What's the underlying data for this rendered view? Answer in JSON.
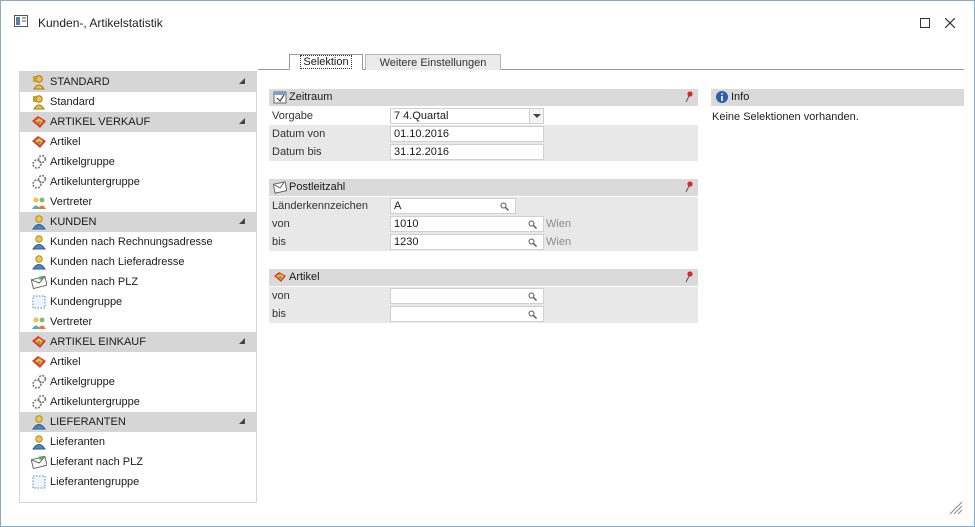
{
  "window": {
    "title": "Kunden-, Artikelstatistik"
  },
  "sidebar": {
    "items": [
      {
        "label": "STANDARD",
        "header": true,
        "icon": "key-person-icon"
      },
      {
        "label": "Standard",
        "header": false,
        "icon": "key-person-icon"
      },
      {
        "label": "ARTIKEL VERKAUF",
        "header": true,
        "icon": "article-icon"
      },
      {
        "label": "Artikel",
        "header": false,
        "icon": "article-icon"
      },
      {
        "label": "Artikelgruppe",
        "header": false,
        "icon": "gear-cluster-icon"
      },
      {
        "label": "Artikeluntergruppe",
        "header": false,
        "icon": "gear-cluster-icon"
      },
      {
        "label": "Vertreter",
        "header": false,
        "icon": "group-people-icon"
      },
      {
        "label": "KUNDEN",
        "header": true,
        "icon": "person-icon"
      },
      {
        "label": "Kunden nach Rechnungsadresse",
        "header": false,
        "icon": "person-icon"
      },
      {
        "label": "Kunden nach Lieferadresse",
        "header": false,
        "icon": "person-icon"
      },
      {
        "label": "Kunden nach PLZ",
        "header": false,
        "icon": "envelope-icon"
      },
      {
        "label": "Kundengruppe",
        "header": false,
        "icon": "dotted-frame-icon"
      },
      {
        "label": "Vertreter",
        "header": false,
        "icon": "group-people-icon"
      },
      {
        "label": "ARTIKEL EINKAUF",
        "header": true,
        "icon": "article-icon"
      },
      {
        "label": "Artikel",
        "header": false,
        "icon": "article-icon"
      },
      {
        "label": "Artikelgruppe",
        "header": false,
        "icon": "gear-cluster-icon"
      },
      {
        "label": "Artikeluntergruppe",
        "header": false,
        "icon": "gear-cluster-icon"
      },
      {
        "label": "LIEFERANTEN",
        "header": true,
        "icon": "person-icon"
      },
      {
        "label": "Lieferanten",
        "header": false,
        "icon": "person-icon"
      },
      {
        "label": "Lieferant nach PLZ",
        "header": false,
        "icon": "envelope-icon"
      },
      {
        "label": "Lieferantengruppe",
        "header": false,
        "icon": "dotted-frame-icon"
      }
    ]
  },
  "tabs": {
    "selektion": "Selektion",
    "weitere": "Weitere Einstellungen"
  },
  "zeitraum": {
    "title": "Zeitraum",
    "vorgabe_label": "Vorgabe",
    "vorgabe_value": "7  4.Quartal",
    "von_label": "Datum von",
    "von_value": "01.10.2016",
    "bis_label": "Datum bis",
    "bis_value": "31.12.2016"
  },
  "plz": {
    "title": "Postleitzahl",
    "land_label": "Länderkennzeichen",
    "land_value": "A",
    "von_label": "von",
    "von_value": "1010",
    "von_city": "Wien",
    "bis_label": "bis",
    "bis_value": "1230",
    "bis_city": "Wien"
  },
  "artikel": {
    "title": "Artikel",
    "von_label": "von",
    "von_value": "",
    "bis_label": "bis",
    "bis_value": ""
  },
  "info": {
    "title": "Info",
    "text": "Keine Selektionen vorhanden."
  },
  "colors": {
    "header_gray": "#d6d6d6",
    "field_shade": "#e8e8e8",
    "border_blue": "#8aa9c9"
  }
}
